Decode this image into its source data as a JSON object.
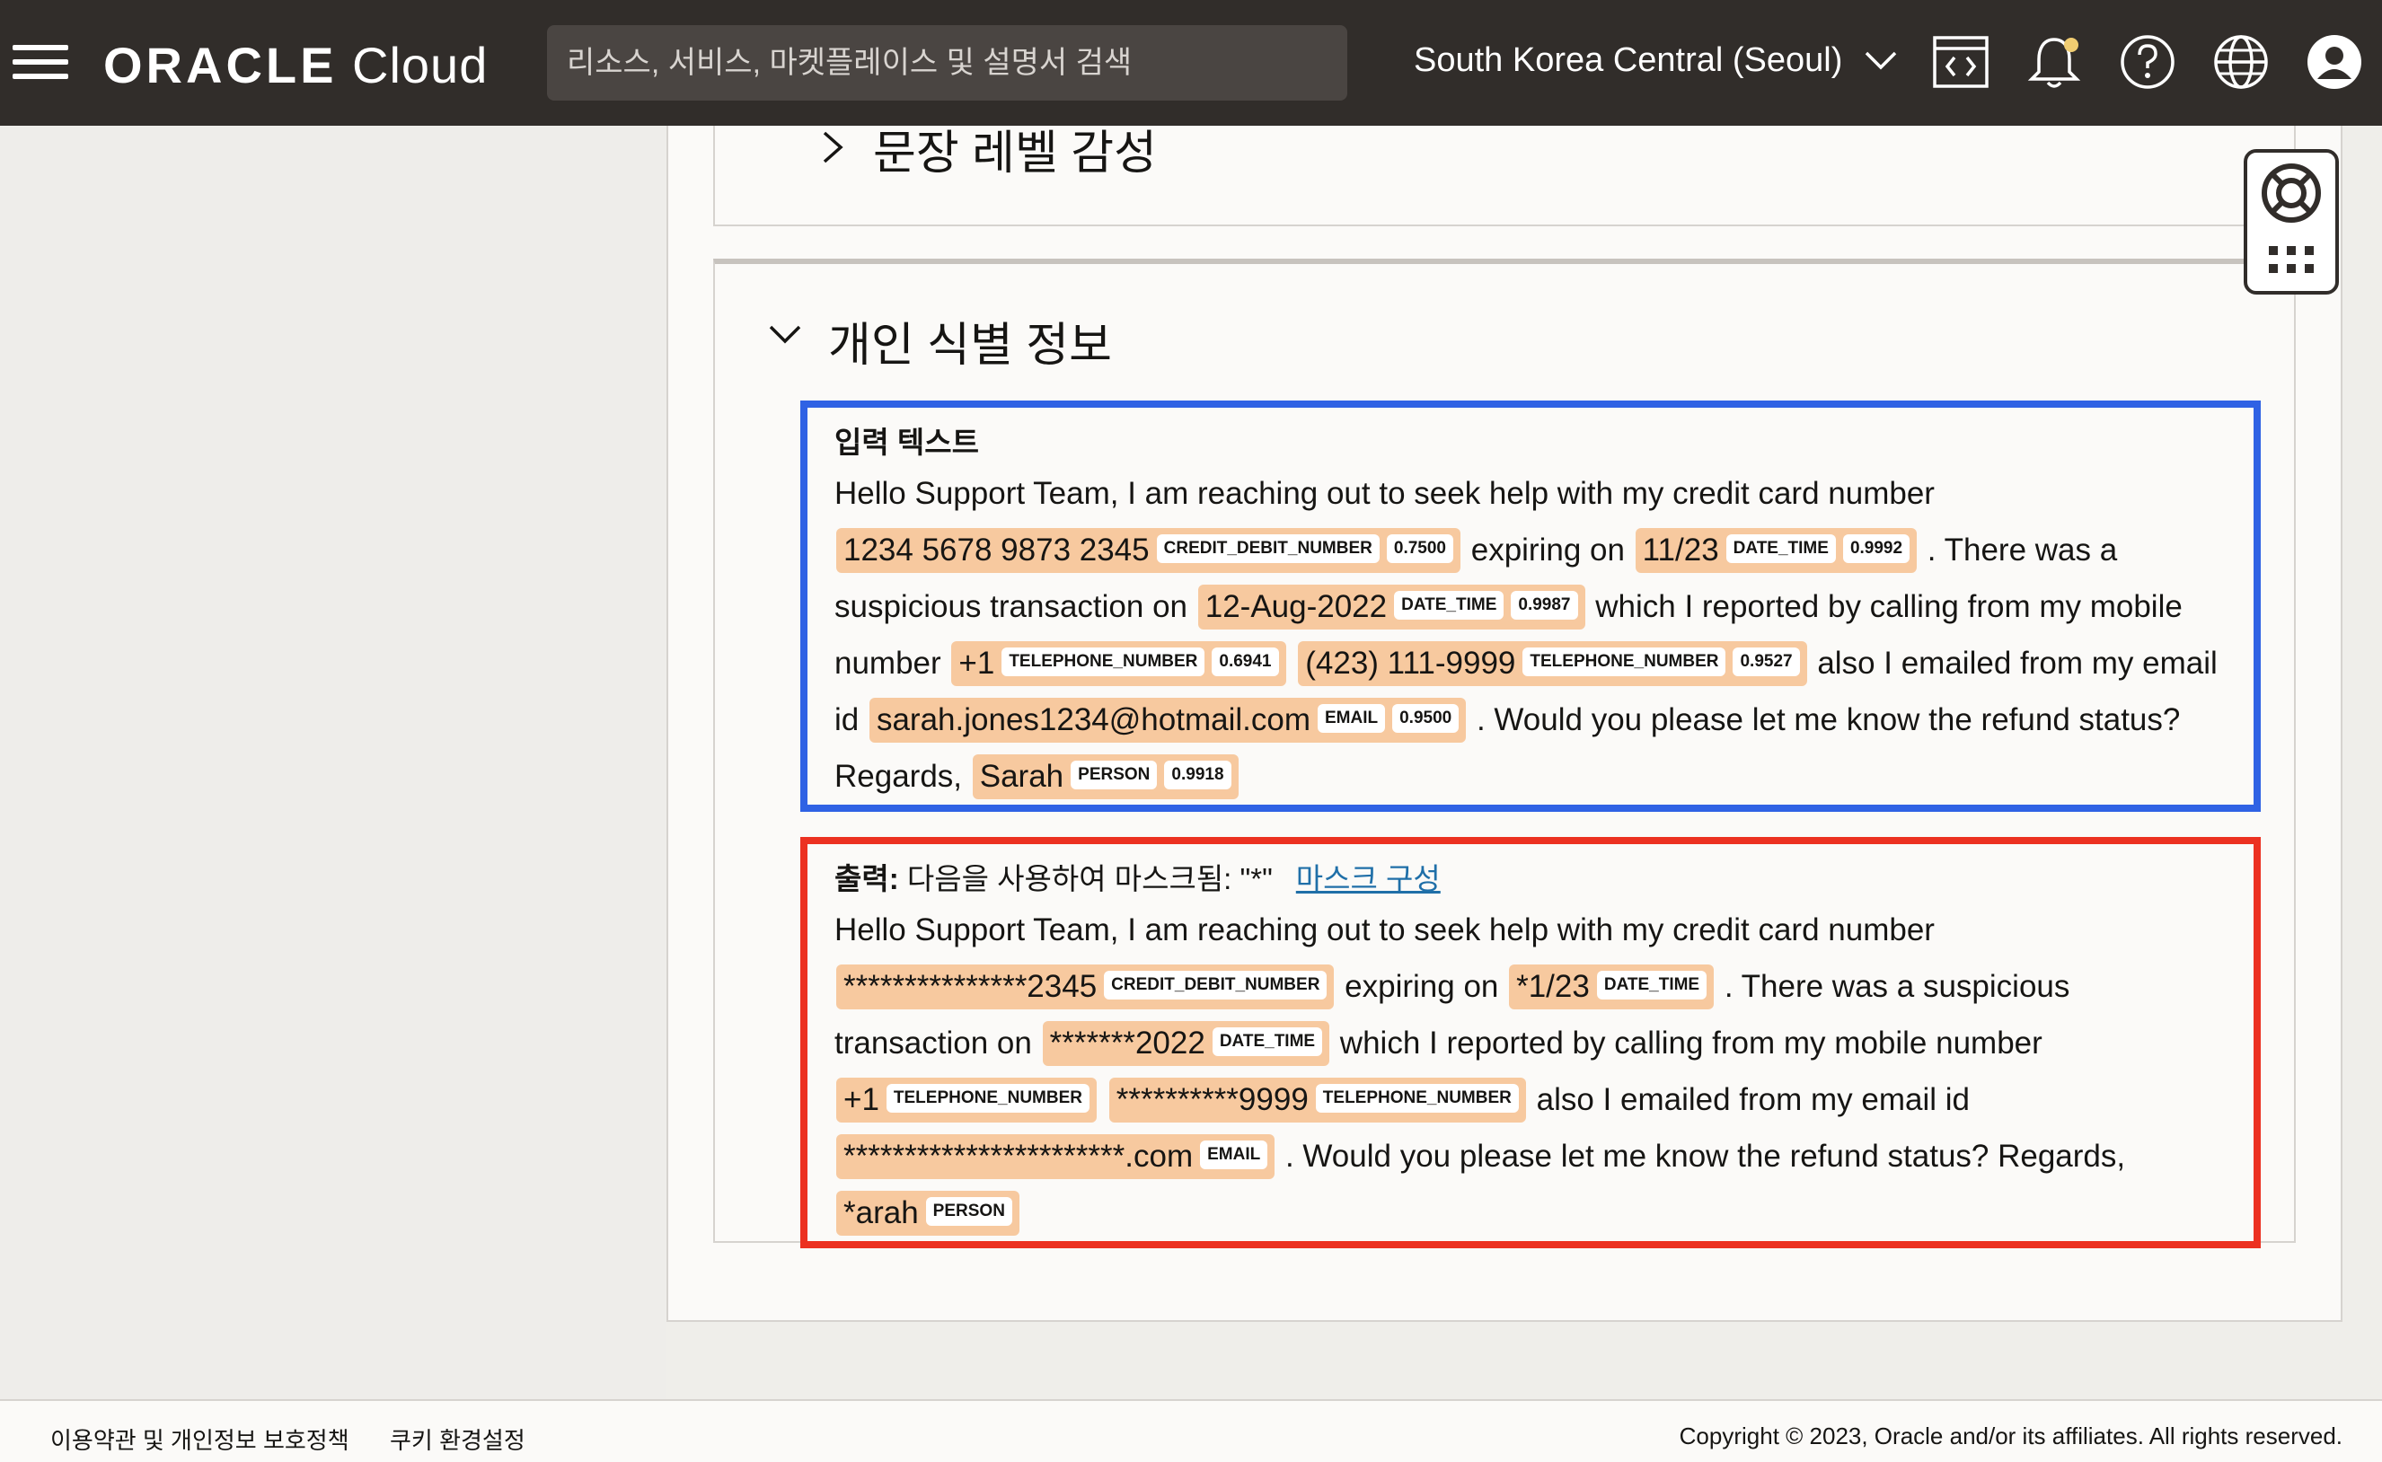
{
  "header": {
    "logo_bold": "ORACLE",
    "logo_light": "Cloud",
    "search_placeholder": "리소스, 서비스, 마켓플레이스 및 설명서 검색",
    "region": "South Korea Central (Seoul)",
    "icons": [
      "menu-icon",
      "code-editor-icon",
      "bell-icon",
      "help-icon",
      "globe-icon",
      "profile-icon"
    ]
  },
  "sections": {
    "sentence_sentiment": "문장 레벨 감성",
    "pii": "개인 식별 정보"
  },
  "input_box": {
    "heading": "입력 텍스트",
    "segments": [
      {
        "t": "Hello Support Team, I am reaching out to seek help with my credit card number "
      },
      {
        "e": "1234 5678 9873 2345",
        "tag": "CREDIT_DEBIT_NUMBER",
        "score": "0.7500"
      },
      {
        "t": " expiring on "
      },
      {
        "e": "11/23",
        "tag": "DATE_TIME",
        "score": "0.9992"
      },
      {
        "t": " . There was a suspicious transaction on "
      },
      {
        "e": "12-Aug-2022",
        "tag": "DATE_TIME",
        "score": "0.9987"
      },
      {
        "t": " which I reported by calling from my mobile number "
      },
      {
        "e": "+1",
        "tag": "TELEPHONE_NUMBER",
        "score": "0.6941"
      },
      {
        "t": " "
      },
      {
        "e": "(423) 111-9999",
        "tag": "TELEPHONE_NUMBER",
        "score": "0.9527"
      },
      {
        "t": " also I emailed from my email id "
      },
      {
        "e": "sarah.jones1234@hotmail.com",
        "tag": "EMAIL",
        "score": "0.9500"
      },
      {
        "t": " . Would you please let me know the refund status? Regards, "
      },
      {
        "e": "Sarah",
        "tag": "PERSON",
        "score": "0.9918"
      }
    ]
  },
  "output_box": {
    "heading_bold": "출력:",
    "heading_text": " 다음을 사용하여 마스크됨: \"*\"",
    "mask_link": "마스크 구성",
    "segments": [
      {
        "t": "Hello Support Team, I am reaching out to seek help with my credit card number "
      },
      {
        "e": "***************2345",
        "tag": "CREDIT_DEBIT_NUMBER"
      },
      {
        "t": " expiring on "
      },
      {
        "e": "*1/23",
        "tag": "DATE_TIME"
      },
      {
        "t": " . There was a suspicious transaction on "
      },
      {
        "e": "*******2022",
        "tag": "DATE_TIME"
      },
      {
        "t": " which I reported by calling from my mobile number "
      },
      {
        "e": "+1",
        "tag": "TELEPHONE_NUMBER"
      },
      {
        "t": " "
      },
      {
        "e": "**********9999",
        "tag": "TELEPHONE_NUMBER"
      },
      {
        "t": " also I emailed from my email id "
      },
      {
        "e": "***********************.com",
        "tag": "EMAIL"
      },
      {
        "t": " . Would you please let me know the refund status? Regards, "
      },
      {
        "e": "*arah",
        "tag": "PERSON"
      }
    ]
  },
  "footer": {
    "terms": "이용약관 및 개인정보 보호정책",
    "cookies": "쿠키 환경설정",
    "copyright": "Copyright © 2023, Oracle and/or its affiliates. All rights reserved."
  },
  "colors": {
    "topbar": "#312d2a",
    "entity_highlight": "#f7c99f",
    "input_border": "#2f62e4",
    "output_border": "#ec3121",
    "link": "#1f6fa8"
  }
}
